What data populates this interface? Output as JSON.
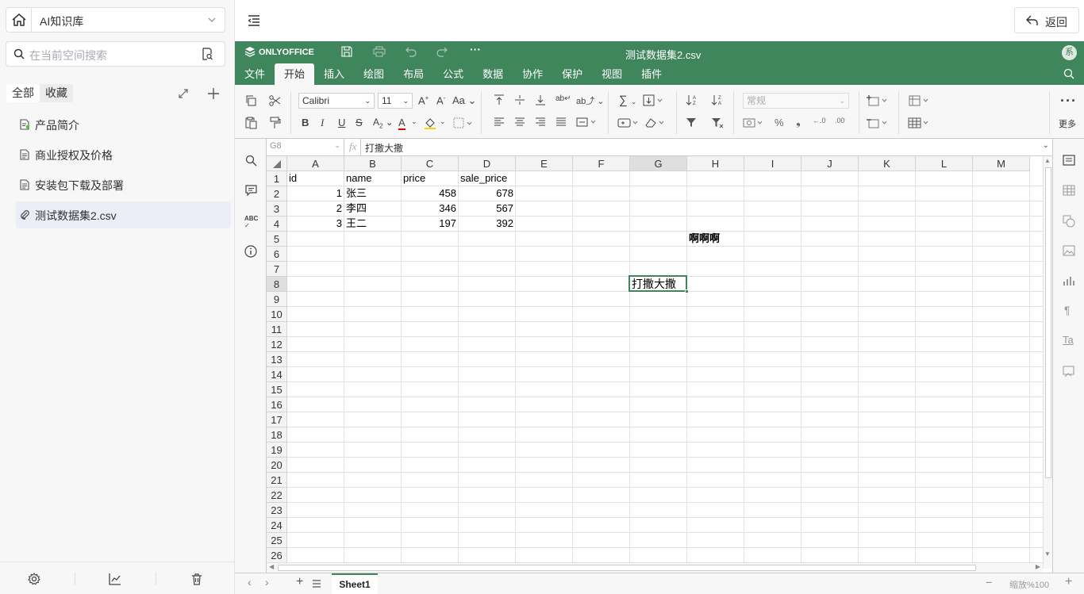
{
  "sidebar": {
    "kb_selector": "AI知识库",
    "search_placeholder": "在当前空间搜索",
    "tabs": [
      "全部",
      "收藏"
    ],
    "docs": [
      {
        "label": "产品简介",
        "icon": "doc-published-icon"
      },
      {
        "label": "商业授权及价格",
        "icon": "doc-icon"
      },
      {
        "label": "安装包下载及部署",
        "icon": "doc-icon"
      },
      {
        "label": "测试数据集2.csv",
        "icon": "attachment-icon"
      }
    ]
  },
  "topbar": {
    "back_label": "返回"
  },
  "editor": {
    "brand": "ONLYOFFICE",
    "file_name": "测试数据集2.csv",
    "user_initial": "系",
    "menu": [
      "文件",
      "开始",
      "插入",
      "绘图",
      "布局",
      "公式",
      "数据",
      "协作",
      "保护",
      "视图",
      "插件"
    ],
    "active_menu": "开始",
    "font_name": "Calibri",
    "font_size": "11",
    "number_format": "常规",
    "more_label": "更多",
    "cell_ref": "G8",
    "fx_label": "fx",
    "formula": "打撒大撒",
    "zoom_label": "缩放%100",
    "sheet_tab": "Sheet1"
  },
  "sheet": {
    "columns": [
      "A",
      "B",
      "C",
      "D",
      "E",
      "F",
      "G",
      "H",
      "I",
      "J",
      "K",
      "L",
      "M"
    ],
    "rows": [
      "1",
      "2",
      "3",
      "4",
      "5",
      "6",
      "7",
      "8",
      "9",
      "10",
      "11",
      "12",
      "13",
      "14",
      "15",
      "16",
      "17",
      "18",
      "19",
      "20",
      "21",
      "22",
      "23",
      "24",
      "25",
      "26"
    ],
    "selected_col": "G",
    "selected_row": "8",
    "cells": {
      "A1": "id",
      "B1": "name",
      "C1": "price",
      "D1": "sale_price",
      "A2": "1",
      "B2": "张三",
      "C2": "458",
      "D2": "678",
      "A3": "2",
      "B3": "李四",
      "C3": "346",
      "D3": "567",
      "A4": "3",
      "B4": "王二",
      "C4": "197",
      "D4": "392",
      "H5": "啊啊啊",
      "G8": "打撒大撒"
    }
  },
  "colors": {
    "brand_green": "#40865c",
    "selection": "#40865c"
  }
}
